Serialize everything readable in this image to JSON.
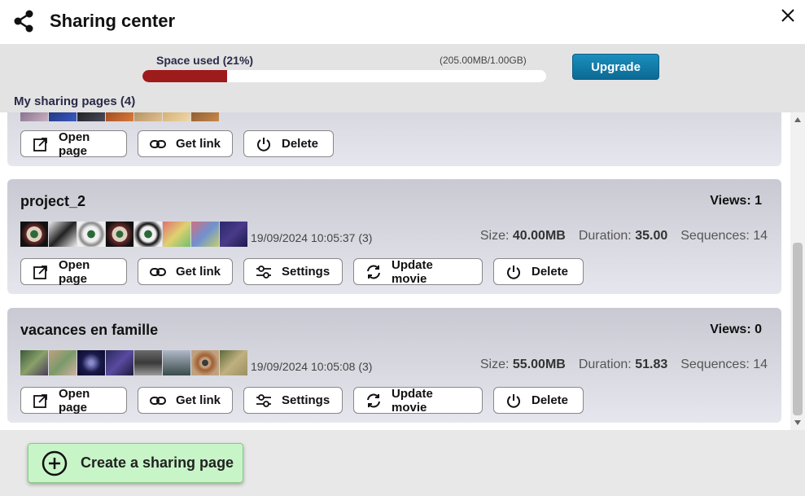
{
  "header": {
    "title": "Sharing center"
  },
  "usage": {
    "space_label": "Space used (21%)",
    "space_amount": "(205.00MB/1.00GB)",
    "percent_used": 21,
    "upgrade_label": "Upgrade",
    "my_pages_label": "My sharing pages (4)"
  },
  "cards": [
    {
      "name": "",
      "views": "",
      "date": "",
      "size_label": "",
      "size_value": "",
      "duration_label": "",
      "duration_value": "",
      "sequences_label": "",
      "actions": {
        "open": "Open page",
        "link": "Get link",
        "delete": "Delete"
      }
    },
    {
      "name": "project_2",
      "views": "Views: 1",
      "date": "19/09/2024 10:05:37 (3)",
      "size_label": "Size:",
      "size_value": "40.00MB",
      "duration_label": "Duration:",
      "duration_value": "35.00",
      "sequences_label": "Sequences: 14",
      "actions": {
        "open": "Open page",
        "link": "Get link",
        "settings": "Settings",
        "update": "Update movie",
        "delete": "Delete"
      }
    },
    {
      "name": "vacances en famille",
      "views": "Views: 0",
      "date": "19/09/2024 10:05:08 (3)",
      "size_label": "Size:",
      "size_value": "55.00MB",
      "duration_label": "Duration:",
      "duration_value": "51.83",
      "sequences_label": "Sequences: 14",
      "actions": {
        "open": "Open page",
        "link": "Get link",
        "settings": "Settings",
        "update": "Update movie",
        "delete": "Delete"
      }
    }
  ],
  "create_label": "Create a sharing page",
  "colors": {
    "usage_bar": "#9e1b1b",
    "upgrade": "#0c6a94",
    "create_bg": "#c8f5c8"
  },
  "icons": [
    "share-icon",
    "close-icon",
    "open-page-icon",
    "link-icon",
    "settings-icon",
    "update-icon",
    "power-icon",
    "plus-circle-icon"
  ]
}
